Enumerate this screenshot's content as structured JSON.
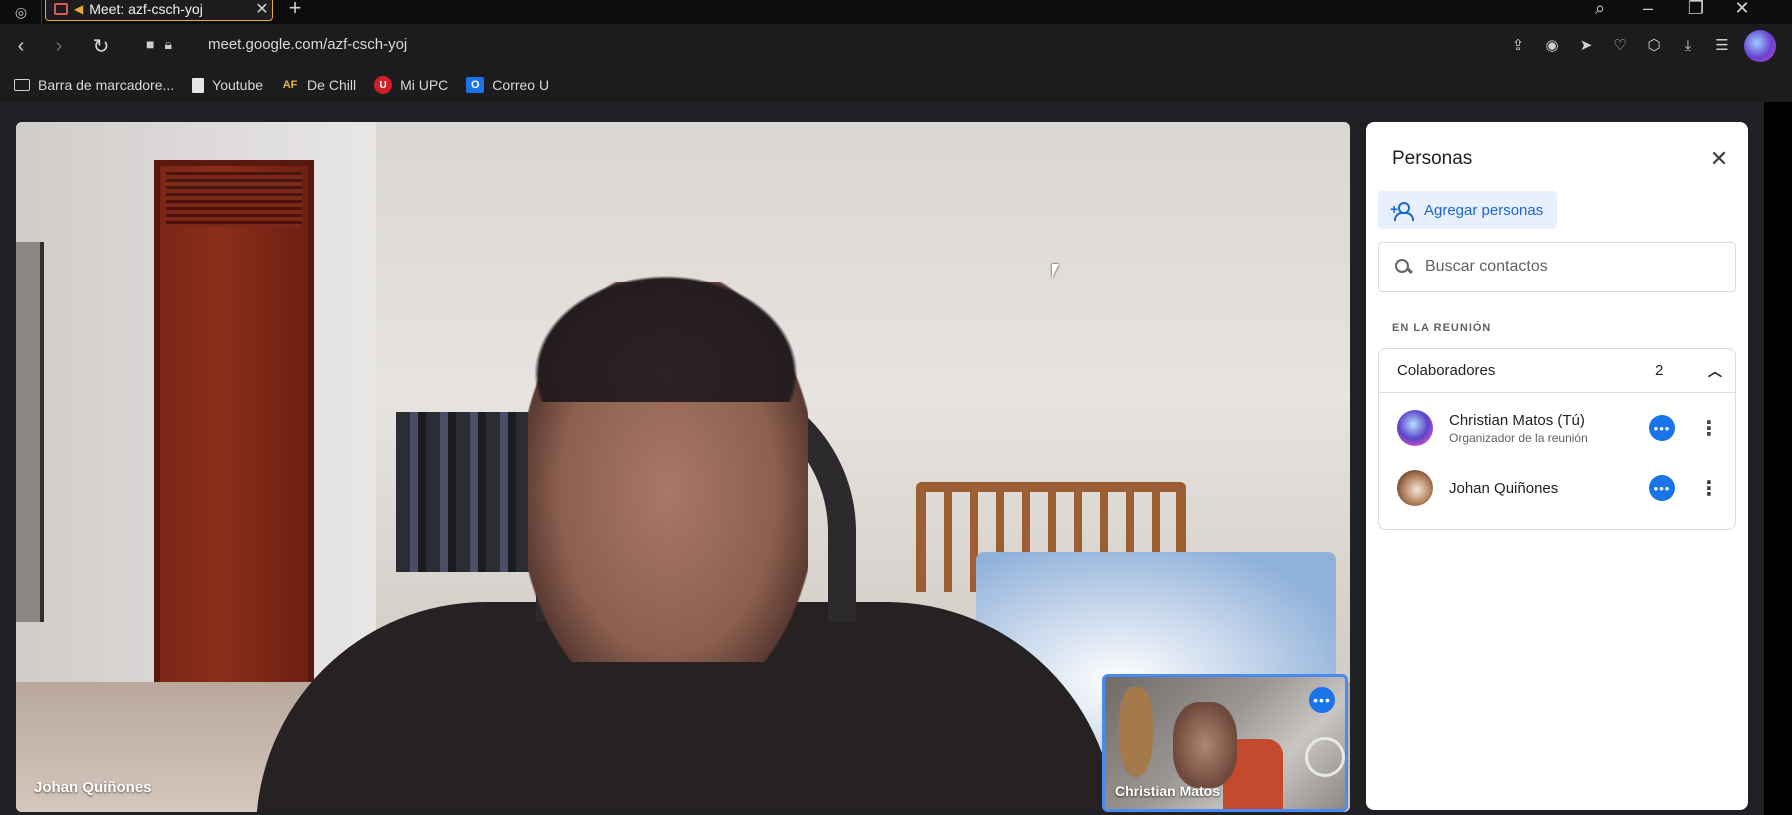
{
  "browser": {
    "tab_title": "Meet: azf-csch-yoj",
    "url": "meet.google.com/azf-csch-yoj",
    "new_tab_symbol": "+",
    "close_symbol": "✕"
  },
  "bookmarks": [
    {
      "label": "Barra de marcadore...",
      "icon": "folder-icon"
    },
    {
      "label": "Youtube",
      "icon": "document-icon"
    },
    {
      "label": "De Chill",
      "icon": "af-icon"
    },
    {
      "label": "Mi UPC",
      "icon": "upc-icon"
    },
    {
      "label": "Correo U",
      "icon": "outlook-icon"
    }
  ],
  "bookmark_icon_text": {
    "af": "AF",
    "upc": "U",
    "outlook": "O"
  },
  "meeting": {
    "main_participant": "Johan Quiñones",
    "self_participant": "Christian Matos"
  },
  "people_panel": {
    "title": "Personas",
    "add_label": "Agregar personas",
    "search_placeholder": "Buscar contactos",
    "section_label": "EN LA REUNIÓN",
    "group_name": "Colaboradores",
    "group_count": "2",
    "participants": [
      {
        "name": "Christian Matos (Tú)",
        "role": "Organizador de la reunión"
      },
      {
        "name": "Johan Quiñones",
        "role": ""
      }
    ]
  },
  "colors": {
    "accent_blue": "#1a73e8",
    "tab_outline": "#e8a83a",
    "meet_background": "#202124"
  }
}
